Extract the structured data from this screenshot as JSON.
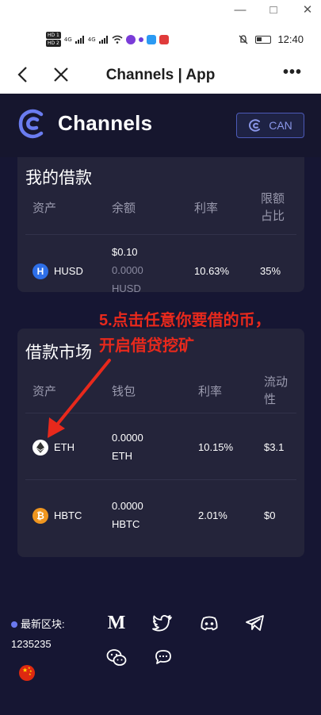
{
  "status_bar": {
    "network_badges": [
      "HD 1",
      "HD 2"
    ],
    "signal_1": "4G",
    "signal_2": "4G",
    "time": "12:40"
  },
  "nav": {
    "title": "Channels | App",
    "more": "•••"
  },
  "header": {
    "logo_text": "Channels",
    "can_button": "CAN",
    "accent": "#5c6ce0"
  },
  "my_loans": {
    "title": "我的借款",
    "headers": {
      "asset": "资产",
      "balance": "余额",
      "rate": "利率",
      "limit_line1": "限额",
      "limit_line2": "占比"
    },
    "rows": [
      {
        "asset": "HUSD",
        "icon": "husd-icon",
        "balance_usd": "$0.10",
        "balance_amount": "0.0000",
        "balance_unit": "HUSD",
        "rate": "10.63%",
        "limit": "35%"
      }
    ]
  },
  "annotation": {
    "line1": "5.点击任意你要借的币，",
    "line2": "开启借贷挖矿",
    "color": "#e8291c"
  },
  "loan_market": {
    "title": "借款市场",
    "headers": {
      "asset": "资产",
      "wallet": "钱包",
      "rate": "利率",
      "liquidity_line1": "流动",
      "liquidity_line2": "性"
    },
    "rows": [
      {
        "asset": "ETH",
        "icon": "eth-icon",
        "wallet_amount": "0.0000",
        "wallet_unit": "ETH",
        "rate": "10.15%",
        "liquidity": "$3.1"
      },
      {
        "asset": "HBTC",
        "icon": "hbtc-icon",
        "wallet_amount": "0.0000",
        "wallet_unit": "HBTC",
        "rate": "2.01%",
        "liquidity": "$0"
      }
    ]
  },
  "footer": {
    "latest_block_label": "最新区块:",
    "latest_block_number": "1235235",
    "social_icons": [
      "medium-icon",
      "twitter-icon",
      "discord-icon",
      "telegram-icon",
      "wechat-icon",
      "chat-icon"
    ]
  }
}
